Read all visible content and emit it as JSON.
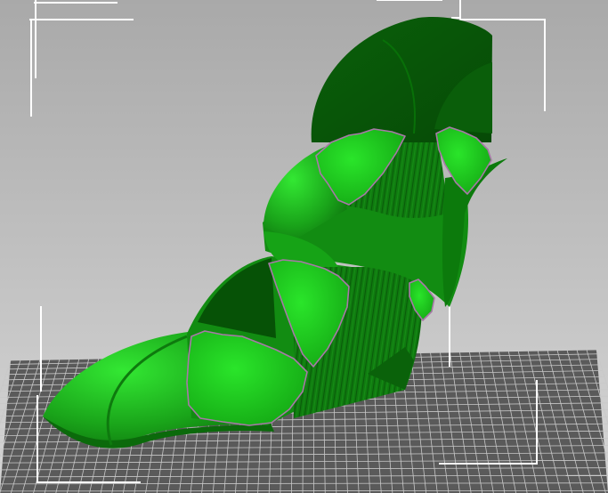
{
  "viewport": {
    "background_top": "#a9a9a9",
    "background_bottom": "#d6d6d6"
  },
  "bed": {
    "surface_color": "#5a5a5a",
    "grid_color": "#c8c8c8"
  },
  "bounding_box": {
    "color": "#ffffff"
  },
  "model": {
    "shape": "curved-heel-shoe",
    "colors": {
      "bright": "#22cc22",
      "mid": "#159915",
      "dark": "#0b6a0b",
      "darkest": "#064c06",
      "cut_face": "#1ed11e",
      "edge": "#a878a8"
    }
  }
}
